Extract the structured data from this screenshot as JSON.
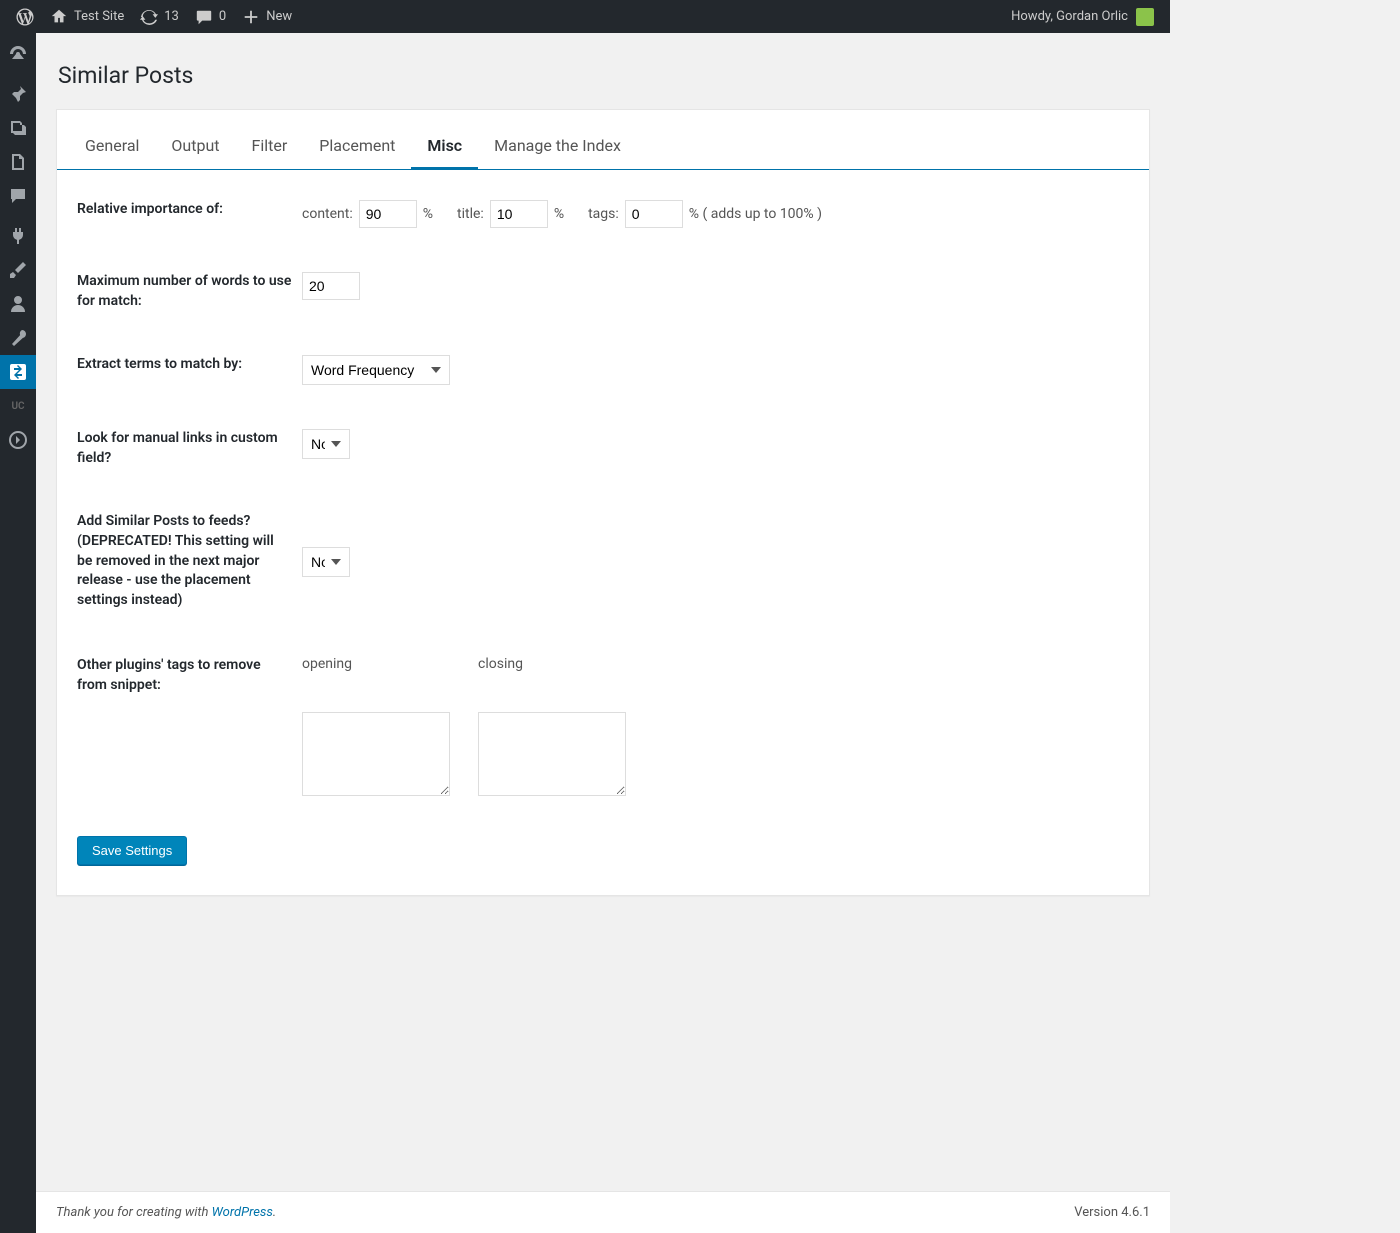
{
  "adminbar": {
    "site_name": "Test Site",
    "updates_count": "13",
    "comments_count": "0",
    "new_label": "New",
    "greeting": "Howdy, Gordan Orlic"
  },
  "page": {
    "title": "Similar Posts"
  },
  "tabs": {
    "general": "General",
    "output": "Output",
    "filter": "Filter",
    "placement": "Placement",
    "misc": "Misc",
    "manage_index": "Manage the Index"
  },
  "fields": {
    "importance": {
      "label": "Relative importance of:",
      "content_label": "content:",
      "content_value": "90",
      "title_label": "title:",
      "title_value": "10",
      "tags_label": "tags:",
      "tags_value": "0",
      "pct": "%",
      "note": "% ( adds up to 100% )"
    },
    "max_words": {
      "label": "Maximum number of words to use for match:",
      "value": "20"
    },
    "extract": {
      "label": "Extract terms to match by:",
      "selected": "Word Frequency"
    },
    "manual_links": {
      "label": "Look for manual links in custom field?",
      "selected": "No"
    },
    "feeds": {
      "label": "Add Similar Posts to feeds? (DEPRECATED! This setting will be removed in the next major release - use the placement settings instead)",
      "selected": "No"
    },
    "snippet": {
      "label": "Other plugins' tags to remove from snippet:",
      "opening_label": "opening",
      "closing_label": "closing",
      "opening_value": "",
      "closing_value": ""
    }
  },
  "buttons": {
    "save": "Save Settings"
  },
  "footer": {
    "thankyou_prefix": "Thank you for creating with ",
    "wp_link": "WordPress",
    "thankyou_suffix": ".",
    "version": "Version 4.6.1"
  }
}
